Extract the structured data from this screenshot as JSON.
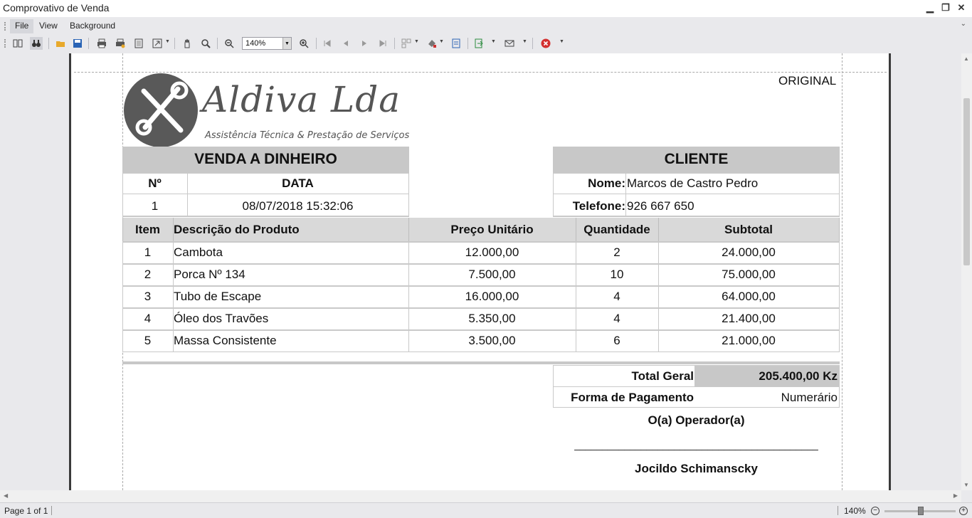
{
  "window": {
    "title": "Comprovativo de Venda"
  },
  "menu": {
    "file": "File",
    "view": "View",
    "background": "Background"
  },
  "toolbar": {
    "zoom": "140%"
  },
  "document": {
    "original_label": "ORIGINAL",
    "logo": {
      "brand": "Aldiva Lda",
      "tagline": "Assistência Técnica & Prestação de Serviços"
    },
    "sale": {
      "title": "VENDA A DINHEIRO",
      "no_label": "Nº",
      "date_label": "DATA",
      "no": "1",
      "date": "08/07/2018 15:32:06"
    },
    "client": {
      "title": "CLIENTE",
      "name_label": "Nome:",
      "name": "Marcos de Castro Pedro",
      "phone_label": "Telefone:",
      "phone": "926 667 650"
    },
    "items_header": {
      "item": "Item",
      "desc": "Descrição do Produto",
      "price": "Preço Unitário",
      "qty": "Quantidade",
      "subtotal": "Subtotal"
    },
    "items": [
      {
        "item": "1",
        "desc": "Cambota",
        "price": "12.000,00",
        "qty": "2",
        "subtotal": "24.000,00"
      },
      {
        "item": "2",
        "desc": "Porca Nº 134",
        "price": "7.500,00",
        "qty": "10",
        "subtotal": "75.000,00"
      },
      {
        "item": "3",
        "desc": "Tubo de Escape",
        "price": "16.000,00",
        "qty": "4",
        "subtotal": "64.000,00"
      },
      {
        "item": "4",
        "desc": "Óleo dos Travões",
        "price": "5.350,00",
        "qty": "4",
        "subtotal": "21.400,00"
      },
      {
        "item": "5",
        "desc": "Massa Consistente",
        "price": "3.500,00",
        "qty": "6",
        "subtotal": "21.000,00"
      }
    ],
    "totals": {
      "total_label": "Total Geral",
      "total": "205.400,00 Kz",
      "payment_label": "Forma de Pagamento",
      "payment": "Numerário"
    },
    "operator": {
      "label": "O(a) Operador(a)",
      "line": "____________________________________________",
      "name": "Jocildo Schimanscky"
    }
  },
  "status": {
    "page": "Page 1 of 1",
    "zoom": "140%"
  }
}
